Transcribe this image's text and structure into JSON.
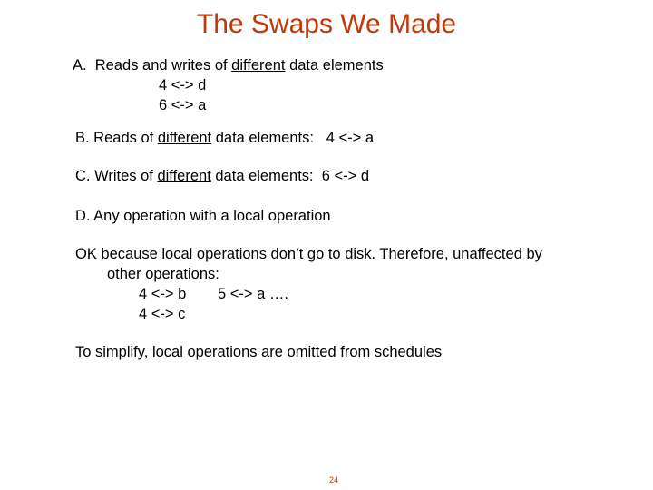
{
  "slide": {
    "title": "The Swaps We Made",
    "page_number": "24",
    "accent_color": "#c0390b"
  },
  "items": {
    "a": {
      "prefix": "A.  Reads and writes of ",
      "underlined": "different",
      "suffix": " data elements",
      "swaps": [
        "4 <-> d",
        "6 <-> a"
      ]
    },
    "b": {
      "prefix": "B. Reads of ",
      "underlined": "different",
      "suffix": " data elements:   4 <-> a"
    },
    "c": {
      "prefix": "C. Writes of ",
      "underlined": "different",
      "suffix": " data elements:  6 <-> d"
    },
    "d": {
      "text": "D. Any operation with a local operation"
    }
  },
  "ok_note": {
    "line1": "OK because local operations don’t go to disk. Therefore, unaffected by",
    "line2": "other operations:",
    "examples_row1_a": "4 <-> b",
    "examples_row1_b": "5 <-> a ….",
    "examples_row2": "4 <-> c"
  },
  "simplify_note": "To simplify, local operations are omitted from schedules"
}
